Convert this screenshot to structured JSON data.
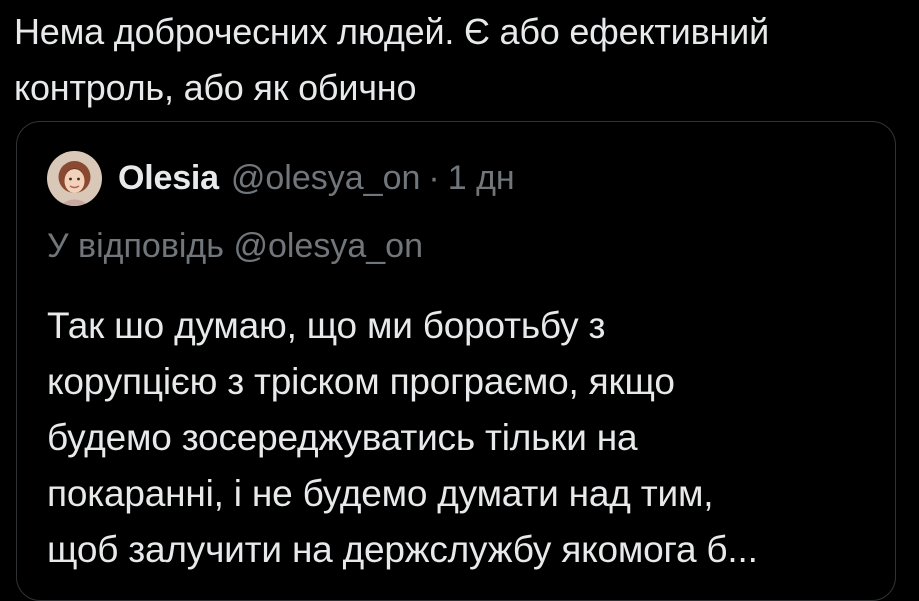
{
  "tweet": {
    "text_lines": [
      "Нема доброчесних людей. Є або ефективний",
      "контроль, або як обично"
    ]
  },
  "quoted_tweet": {
    "display_name": "Olesia",
    "handle": "@olesya_on",
    "separator": "·",
    "time": "1 дн",
    "reply_prefix": "У відповідь",
    "reply_handle": "@olesya_on",
    "text_lines": [
      "Так шо думаю, що ми боротьбу з",
      "корупцією з тріском програємо, якщо",
      "будемо зосереджуватись тільки на",
      "покаранні, і не будемо думати над тим,",
      "щоб залучити на держслужбу якомога б..."
    ],
    "avatar_icon": "user-avatar-photo"
  },
  "colors": {
    "background": "#000000",
    "primary_text": "#e7e9ea",
    "secondary_text": "#71767b",
    "border": "#2f3336"
  }
}
